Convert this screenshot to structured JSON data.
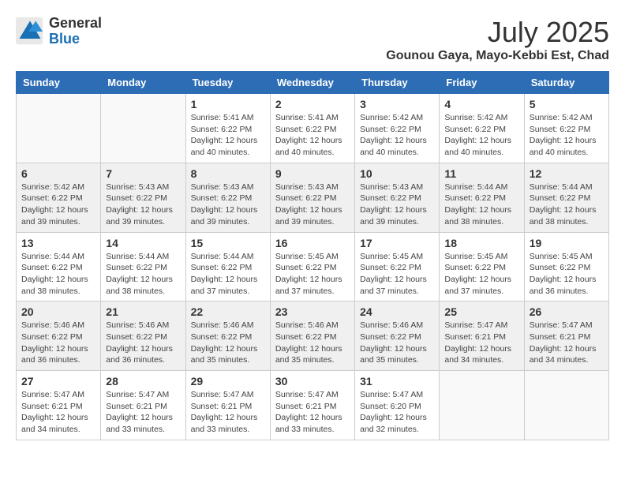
{
  "logo": {
    "general": "General",
    "blue": "Blue"
  },
  "title": {
    "month_year": "July 2025",
    "location": "Gounou Gaya, Mayo-Kebbi Est, Chad"
  },
  "weekdays": [
    "Sunday",
    "Monday",
    "Tuesday",
    "Wednesday",
    "Thursday",
    "Friday",
    "Saturday"
  ],
  "weeks": [
    [
      {
        "day": "",
        "empty": true
      },
      {
        "day": "",
        "empty": true
      },
      {
        "day": "1",
        "sunrise": "5:41 AM",
        "sunset": "6:22 PM",
        "daylight": "12 hours and 40 minutes."
      },
      {
        "day": "2",
        "sunrise": "5:41 AM",
        "sunset": "6:22 PM",
        "daylight": "12 hours and 40 minutes."
      },
      {
        "day": "3",
        "sunrise": "5:42 AM",
        "sunset": "6:22 PM",
        "daylight": "12 hours and 40 minutes."
      },
      {
        "day": "4",
        "sunrise": "5:42 AM",
        "sunset": "6:22 PM",
        "daylight": "12 hours and 40 minutes."
      },
      {
        "day": "5",
        "sunrise": "5:42 AM",
        "sunset": "6:22 PM",
        "daylight": "12 hours and 40 minutes."
      }
    ],
    [
      {
        "day": "6",
        "sunrise": "5:42 AM",
        "sunset": "6:22 PM",
        "daylight": "12 hours and 39 minutes."
      },
      {
        "day": "7",
        "sunrise": "5:43 AM",
        "sunset": "6:22 PM",
        "daylight": "12 hours and 39 minutes."
      },
      {
        "day": "8",
        "sunrise": "5:43 AM",
        "sunset": "6:22 PM",
        "daylight": "12 hours and 39 minutes."
      },
      {
        "day": "9",
        "sunrise": "5:43 AM",
        "sunset": "6:22 PM",
        "daylight": "12 hours and 39 minutes."
      },
      {
        "day": "10",
        "sunrise": "5:43 AM",
        "sunset": "6:22 PM",
        "daylight": "12 hours and 39 minutes."
      },
      {
        "day": "11",
        "sunrise": "5:44 AM",
        "sunset": "6:22 PM",
        "daylight": "12 hours and 38 minutes."
      },
      {
        "day": "12",
        "sunrise": "5:44 AM",
        "sunset": "6:22 PM",
        "daylight": "12 hours and 38 minutes."
      }
    ],
    [
      {
        "day": "13",
        "sunrise": "5:44 AM",
        "sunset": "6:22 PM",
        "daylight": "12 hours and 38 minutes."
      },
      {
        "day": "14",
        "sunrise": "5:44 AM",
        "sunset": "6:22 PM",
        "daylight": "12 hours and 38 minutes."
      },
      {
        "day": "15",
        "sunrise": "5:44 AM",
        "sunset": "6:22 PM",
        "daylight": "12 hours and 37 minutes."
      },
      {
        "day": "16",
        "sunrise": "5:45 AM",
        "sunset": "6:22 PM",
        "daylight": "12 hours and 37 minutes."
      },
      {
        "day": "17",
        "sunrise": "5:45 AM",
        "sunset": "6:22 PM",
        "daylight": "12 hours and 37 minutes."
      },
      {
        "day": "18",
        "sunrise": "5:45 AM",
        "sunset": "6:22 PM",
        "daylight": "12 hours and 37 minutes."
      },
      {
        "day": "19",
        "sunrise": "5:45 AM",
        "sunset": "6:22 PM",
        "daylight": "12 hours and 36 minutes."
      }
    ],
    [
      {
        "day": "20",
        "sunrise": "5:46 AM",
        "sunset": "6:22 PM",
        "daylight": "12 hours and 36 minutes."
      },
      {
        "day": "21",
        "sunrise": "5:46 AM",
        "sunset": "6:22 PM",
        "daylight": "12 hours and 36 minutes."
      },
      {
        "day": "22",
        "sunrise": "5:46 AM",
        "sunset": "6:22 PM",
        "daylight": "12 hours and 35 minutes."
      },
      {
        "day": "23",
        "sunrise": "5:46 AM",
        "sunset": "6:22 PM",
        "daylight": "12 hours and 35 minutes."
      },
      {
        "day": "24",
        "sunrise": "5:46 AM",
        "sunset": "6:22 PM",
        "daylight": "12 hours and 35 minutes."
      },
      {
        "day": "25",
        "sunrise": "5:47 AM",
        "sunset": "6:21 PM",
        "daylight": "12 hours and 34 minutes."
      },
      {
        "day": "26",
        "sunrise": "5:47 AM",
        "sunset": "6:21 PM",
        "daylight": "12 hours and 34 minutes."
      }
    ],
    [
      {
        "day": "27",
        "sunrise": "5:47 AM",
        "sunset": "6:21 PM",
        "daylight": "12 hours and 34 minutes."
      },
      {
        "day": "28",
        "sunrise": "5:47 AM",
        "sunset": "6:21 PM",
        "daylight": "12 hours and 33 minutes."
      },
      {
        "day": "29",
        "sunrise": "5:47 AM",
        "sunset": "6:21 PM",
        "daylight": "12 hours and 33 minutes."
      },
      {
        "day": "30",
        "sunrise": "5:47 AM",
        "sunset": "6:21 PM",
        "daylight": "12 hours and 33 minutes."
      },
      {
        "day": "31",
        "sunrise": "5:47 AM",
        "sunset": "6:20 PM",
        "daylight": "12 hours and 32 minutes."
      },
      {
        "day": "",
        "empty": true
      },
      {
        "day": "",
        "empty": true
      }
    ]
  ],
  "labels": {
    "sunrise": "Sunrise:",
    "sunset": "Sunset:",
    "daylight": "Daylight:"
  }
}
